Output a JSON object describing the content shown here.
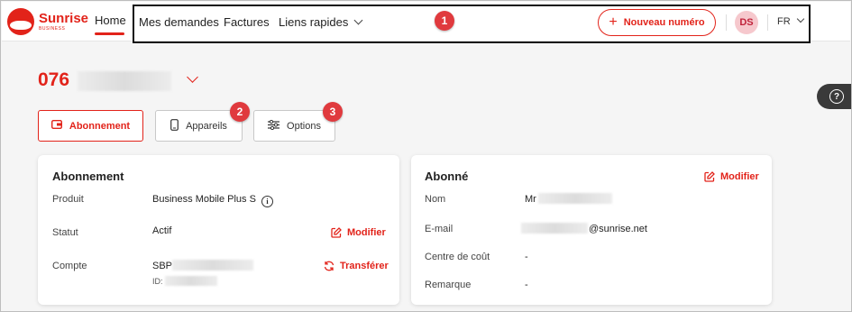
{
  "brand": {
    "name": "Sunrise",
    "sub": "BUSINESS",
    "color": "#e2231a"
  },
  "nav": {
    "home": "Home",
    "items": [
      "Mes demandes",
      "Factures",
      "Liens rapides"
    ],
    "new_number": "Nouveau numéro",
    "avatar": "DS",
    "lang": "FR"
  },
  "badges": [
    "1",
    "2",
    "3"
  ],
  "phone_prefix": "076",
  "tabs": [
    {
      "label": "Abonnement",
      "icon": "wallet-icon"
    },
    {
      "label": "Appareils",
      "icon": "phone-icon"
    },
    {
      "label": "Options",
      "icon": "sliders-icon"
    }
  ],
  "help_icon": "?",
  "abonnement": {
    "title": "Abonnement",
    "rows": {
      "produit": {
        "label": "Produit",
        "value": "Business Mobile Plus S"
      },
      "statut": {
        "label": "Statut",
        "value": "Actif",
        "action": "Modifier"
      },
      "compte": {
        "label": "Compte",
        "value": "SBP",
        "sub": "ID:",
        "action": "Transférer"
      }
    }
  },
  "abonne": {
    "title": "Abonné",
    "action": "Modifier",
    "rows": {
      "nom": {
        "label": "Nom",
        "value": "Mr"
      },
      "email": {
        "label": "E-mail",
        "value": "@sunrise.net"
      },
      "centre": {
        "label": "Centre de coût",
        "value": "-"
      },
      "remarque": {
        "label": "Remarque",
        "value": "-"
      }
    }
  }
}
